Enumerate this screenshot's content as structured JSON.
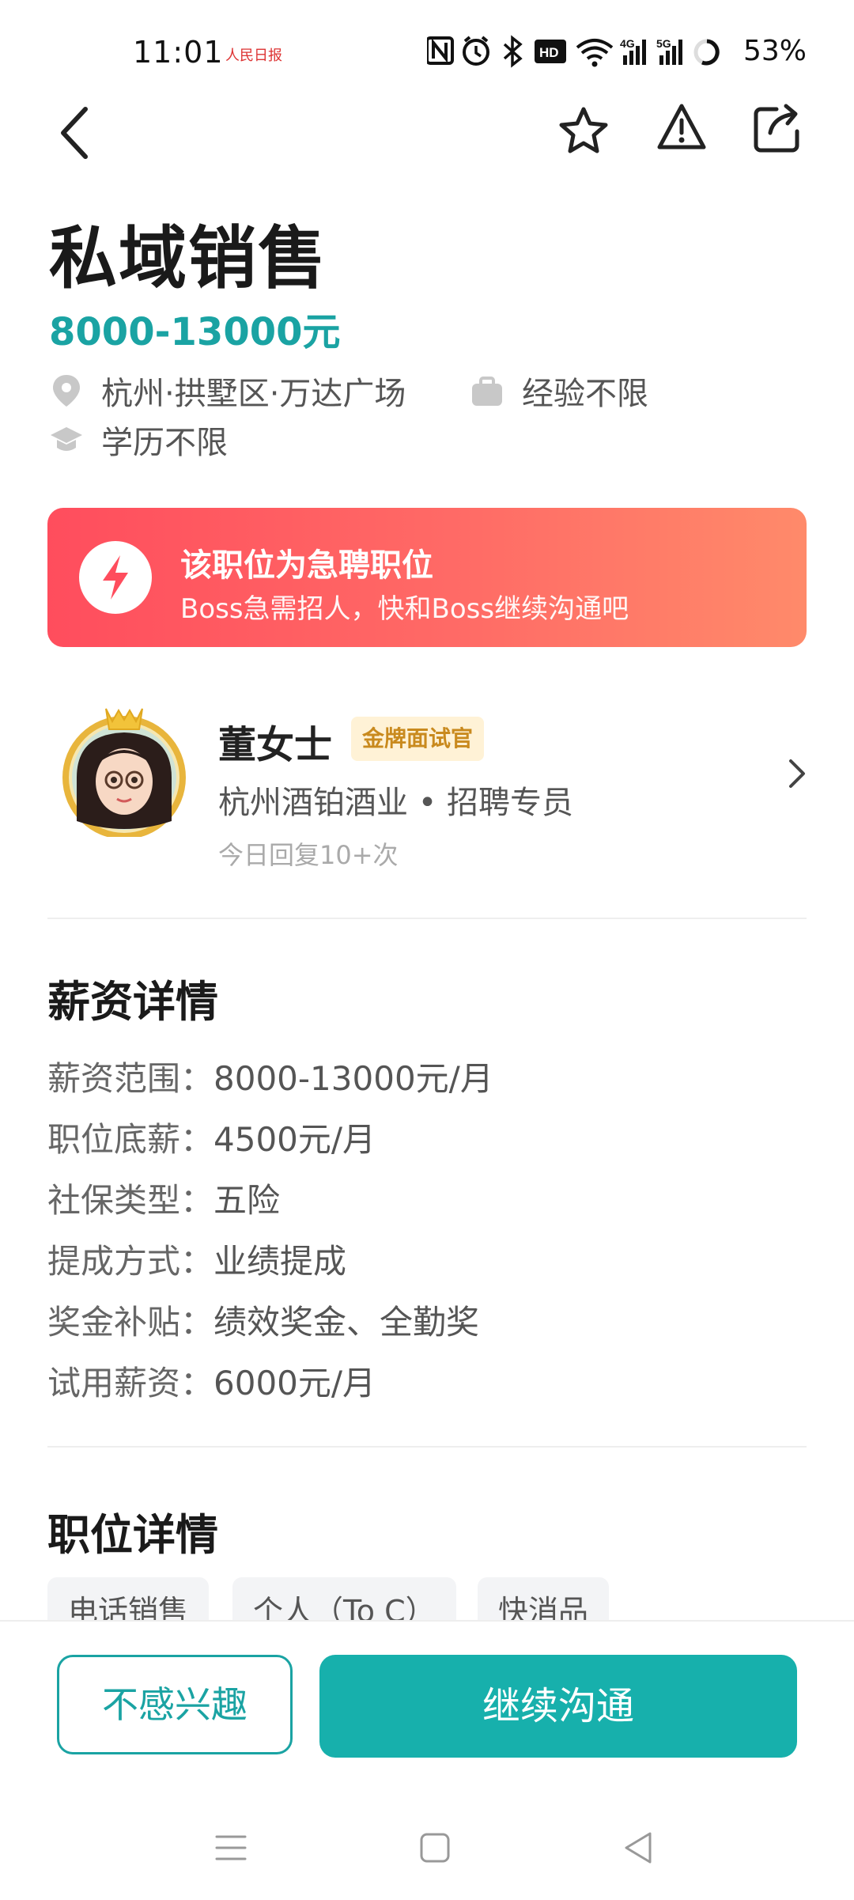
{
  "status_bar": {
    "time": "11:01",
    "app_logo_text": "人民日报",
    "network_4g": "4G",
    "network_5g": "5G",
    "battery": "53%",
    "icons": [
      "nfc-icon",
      "alarm-icon",
      "bluetooth-icon",
      "hd-voice-icon",
      "wifi-icon",
      "signal-4g-icon",
      "signal-5g-icon",
      "battery-icon"
    ]
  },
  "nav": {
    "icons": [
      "back-icon",
      "favorite-star-icon",
      "report-alert-icon",
      "share-icon"
    ]
  },
  "job": {
    "title": "私域销售",
    "salary": "8000-13000元",
    "location": "杭州·拱墅区·万达广场",
    "experience": "经验不限",
    "education": "学历不限"
  },
  "urgent": {
    "title": "该职位为急聘职位",
    "subtitle": "Boss急需招人，快和Boss继续沟通吧"
  },
  "recruiter": {
    "name": "董女士",
    "badge": "金牌面试官",
    "company_role": "杭州酒铂酒业 • 招聘专员",
    "reply_stats": "今日回复10+次"
  },
  "salary_details": {
    "heading": "薪资详情",
    "rows": [
      {
        "label": "薪资范围：",
        "value": "8000-13000元/月"
      },
      {
        "label": "职位底薪：",
        "value": "4500元/月"
      },
      {
        "label": "社保类型：",
        "value": "五险"
      },
      {
        "label": "提成方式：",
        "value": "业绩提成"
      },
      {
        "label": "奖金补贴：",
        "value": "绩效奖金、全勤奖"
      },
      {
        "label": "试用薪资：",
        "value": "6000元/月"
      }
    ]
  },
  "job_details": {
    "heading": "职位详情",
    "tags": [
      "电话销售",
      "个人（To C）",
      "快消品"
    ]
  },
  "actions": {
    "not_interested": "不感兴趣",
    "continue_chat": "继续沟通"
  },
  "colors": {
    "accent": "#17b0ac",
    "salary_text": "#1aa3a3",
    "urgent_start": "#ff4d5d",
    "urgent_end": "#ff8a6a",
    "badge_bg": "#fff2d6",
    "badge_text": "#c98a1e"
  }
}
